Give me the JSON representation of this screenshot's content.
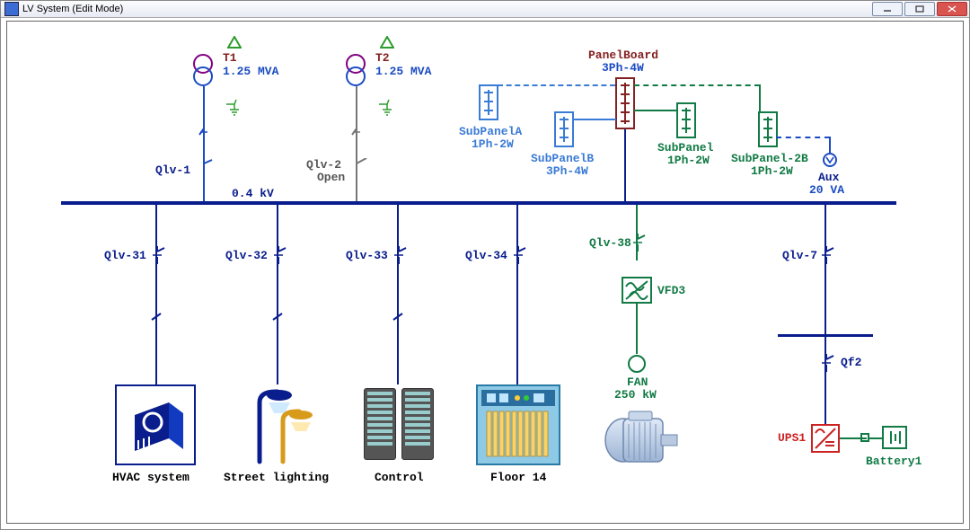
{
  "window": {
    "title": "LV System (Edit Mode)"
  },
  "busbar": {
    "voltage": "0.4 kV"
  },
  "transformers": [
    {
      "id": "T1",
      "rating": "1.25 MVA"
    },
    {
      "id": "T2",
      "rating": "1.25 MVA"
    }
  ],
  "breakers": {
    "qlv1": "Qlv-1",
    "qlv2": "Qlv-2",
    "qlv2_state": "Open",
    "qlv31": "Qlv-31",
    "qlv32": "Qlv-32",
    "qlv33": "Qlv-33",
    "qlv34": "Qlv-34",
    "qlv38": "Qlv-38",
    "qlv7": "Qlv-7",
    "qf2": "Qf2"
  },
  "panels": {
    "main": {
      "name": "PanelBoard",
      "config": "3Ph-4W"
    },
    "subA": {
      "name": "SubPanelA",
      "config": "1Ph-2W"
    },
    "subB": {
      "name": "SubPanelB",
      "config": "3Ph-4W"
    },
    "sub": {
      "name": "SubPanel",
      "config": "1Ph-2W"
    },
    "sub2B": {
      "name": "SubPanel-2B",
      "config": "1Ph-2W"
    },
    "aux": {
      "name": "Aux",
      "rating": "20 VA"
    }
  },
  "vfd": {
    "name": "VFD3"
  },
  "fan": {
    "name": "FAN",
    "rating": "250 kW"
  },
  "ups": {
    "name": "UPS1"
  },
  "battery": {
    "name": "Battery1"
  },
  "loads": {
    "hvac": "HVAC system",
    "street": "Street lighting",
    "control": "Control",
    "floor14": "Floor 14"
  }
}
